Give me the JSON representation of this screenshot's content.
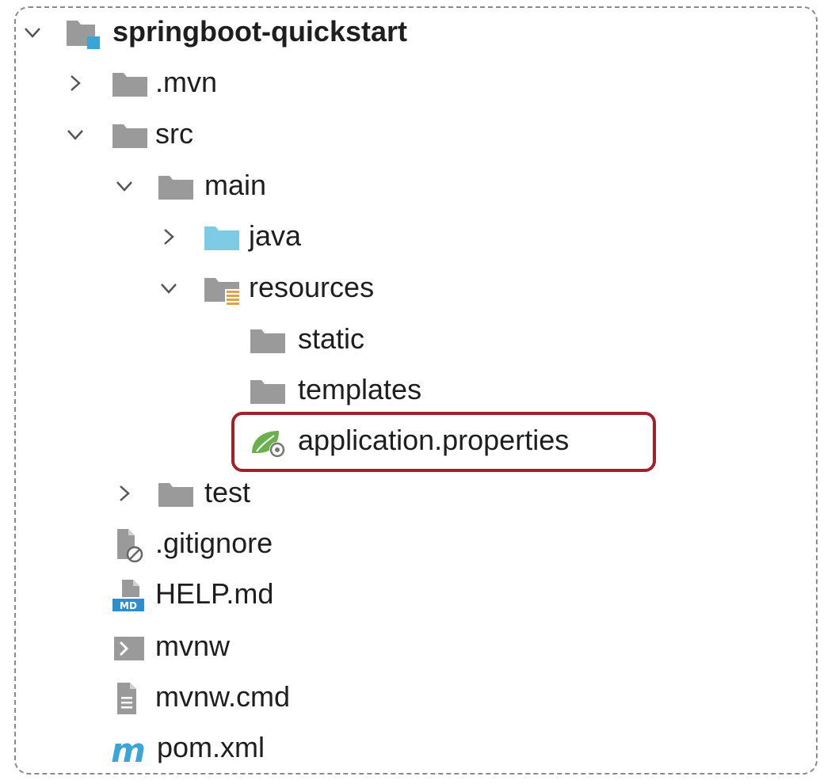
{
  "project_tree": {
    "root": {
      "label": "springboot-quickstart",
      "expanded": true
    },
    "mvn": {
      "label": ".mvn",
      "expanded": false
    },
    "src": {
      "label": "src",
      "expanded": true
    },
    "main": {
      "label": "main",
      "expanded": true
    },
    "java": {
      "label": "java",
      "expanded": false
    },
    "resources": {
      "label": "resources",
      "expanded": true
    },
    "static": {
      "label": "static"
    },
    "templates": {
      "label": "templates"
    },
    "application_properties": {
      "label": "application.properties",
      "highlighted": true
    },
    "test": {
      "label": "test",
      "expanded": false
    },
    "gitignore": {
      "label": ".gitignore"
    },
    "help_md": {
      "label": "HELP.md",
      "badge": "MD"
    },
    "mvnw": {
      "label": "mvnw"
    },
    "mvnw_cmd": {
      "label": "mvnw.cmd"
    },
    "pom_xml": {
      "label": "pom.xml",
      "badge": "m"
    }
  },
  "colors": {
    "folder_gray": "#9a9a9a",
    "source_blue": "#7ecbe6",
    "module_blue": "#3aa6d8",
    "spring_green": "#6ab04c",
    "highlight_red": "#a3202a",
    "text": "#1e1e1e"
  },
  "icons": {
    "expand": "chevron-down-icon",
    "collapse": "chevron-right-icon",
    "folder": "folder-icon",
    "module": "module-folder-icon",
    "source_root": "source-folder-icon",
    "resources_root": "resources-folder-icon",
    "spring_config": "spring-properties-icon",
    "ignore": "ignore-file-icon",
    "markdown": "markdown-file-icon",
    "shell": "shell-script-icon",
    "text_file": "text-file-icon",
    "maven": "maven-icon"
  }
}
